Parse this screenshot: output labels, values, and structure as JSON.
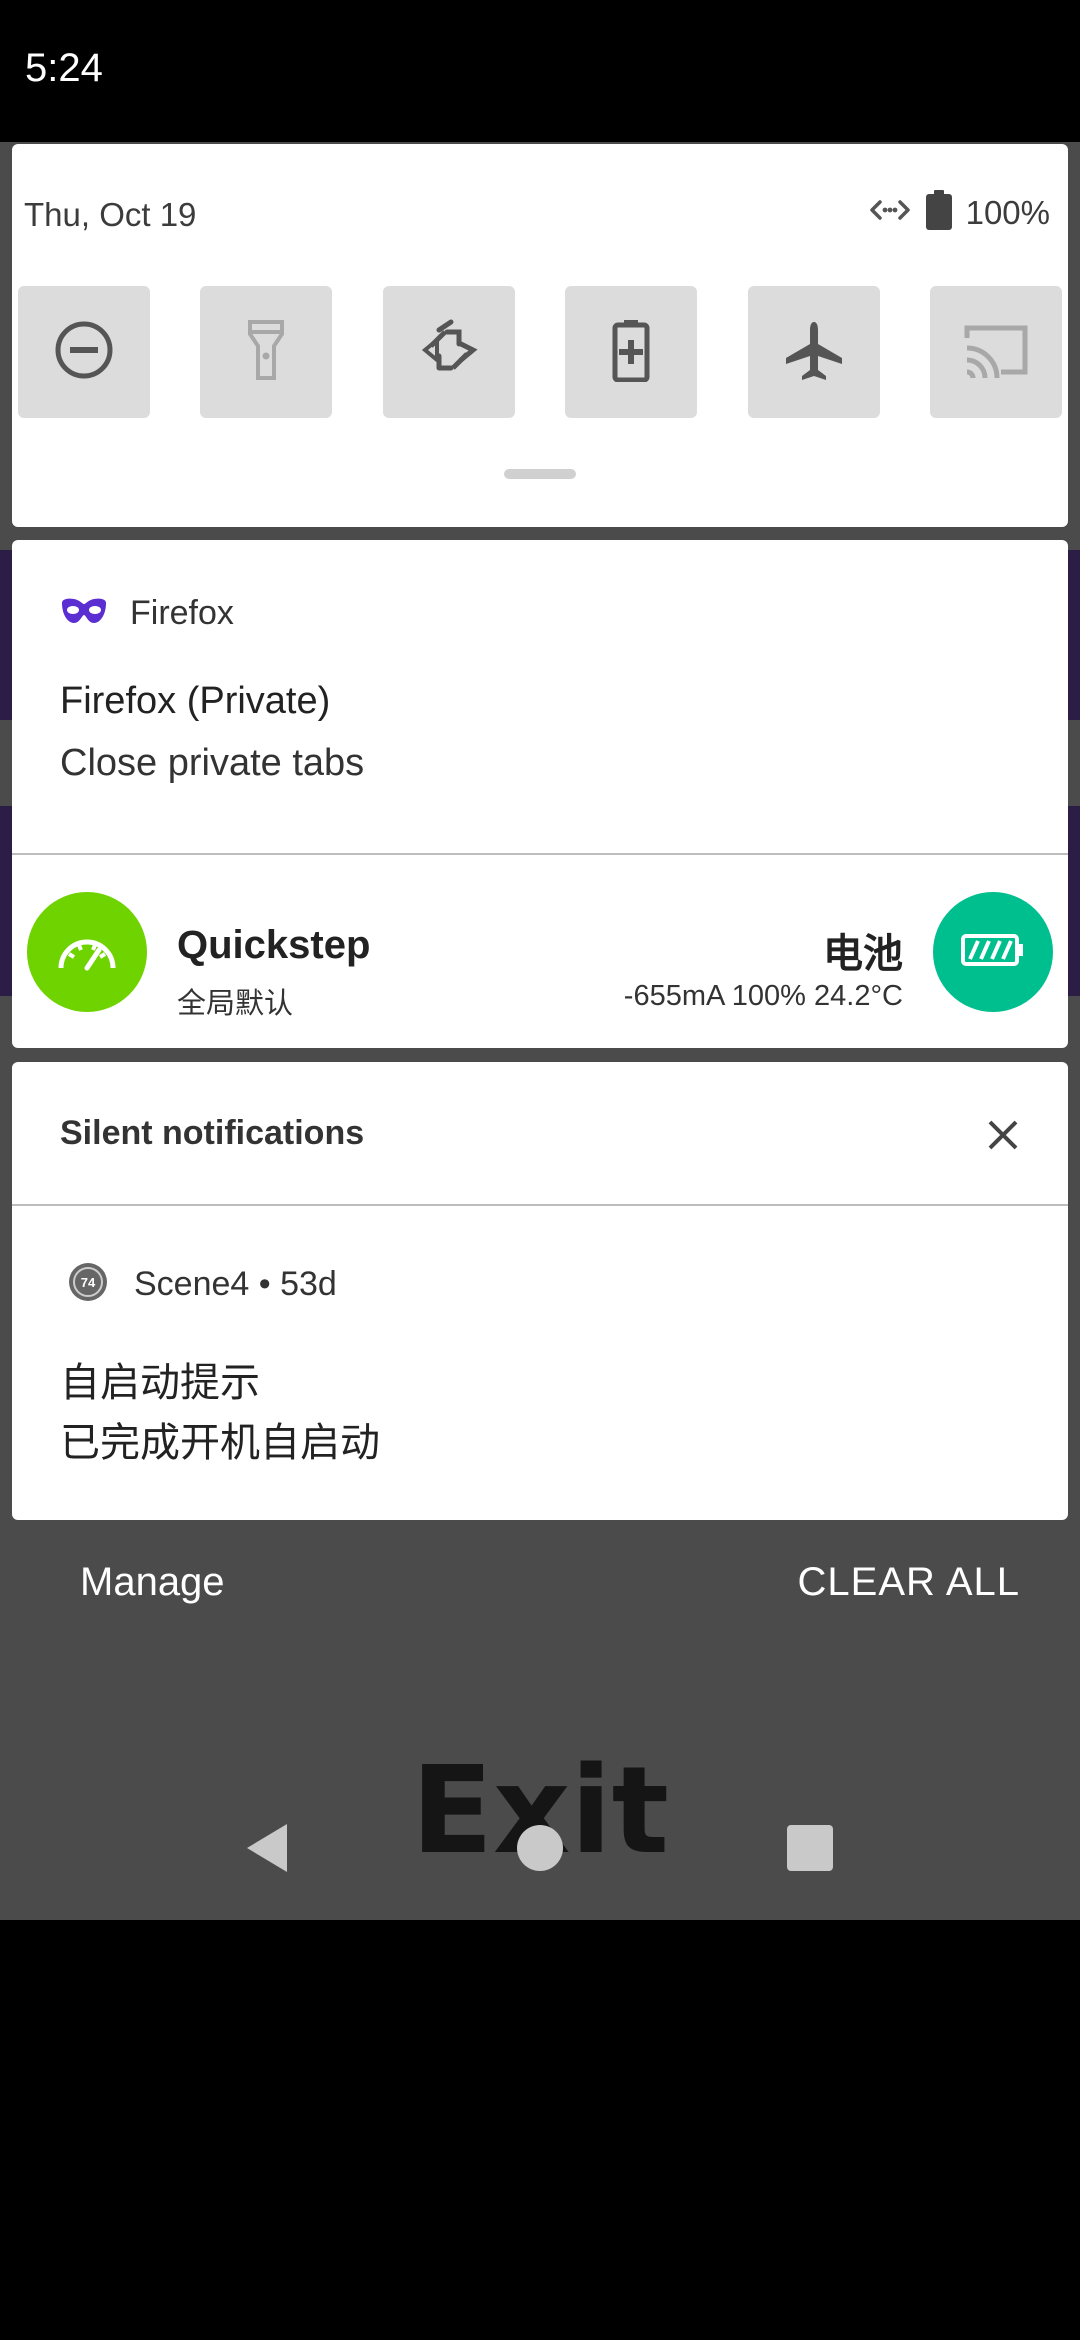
{
  "status_bar": {
    "time": "5:24"
  },
  "quick_settings": {
    "date": "Thu, Oct 19",
    "battery_level": "100%",
    "tiles": [
      {
        "name": "do-not-disturb",
        "icon": "minus-circle-icon",
        "active": true
      },
      {
        "name": "flashlight",
        "icon": "flashlight-icon",
        "active": false
      },
      {
        "name": "auto-rotate",
        "icon": "rotate-icon",
        "active": true
      },
      {
        "name": "battery-saver",
        "icon": "battery-plus-icon",
        "active": true
      },
      {
        "name": "airplane-mode",
        "icon": "airplane-icon",
        "active": true
      },
      {
        "name": "cast",
        "icon": "cast-icon",
        "active": false
      }
    ]
  },
  "firefox_notification": {
    "app_name": "Firefox",
    "title": "Firefox (Private)",
    "text": "Close private tabs"
  },
  "quickstep_row": {
    "left_name": "Quickstep",
    "left_sub": "全局默认",
    "right_name": "电池",
    "right_info": "-655mA 100% 24.2°C",
    "left_color": "#6fd300",
    "right_color": "#00bf8f"
  },
  "silent_section": {
    "header": "Silent notifications",
    "scene_app": "Scene4 • 53d",
    "scene_badge": "74",
    "title": "自启动提示",
    "text": "已完成开机自启动"
  },
  "actions": {
    "manage": "Manage",
    "clear_all": "CLEAR ALL"
  },
  "background_app": {
    "exit_label": "Exit"
  }
}
